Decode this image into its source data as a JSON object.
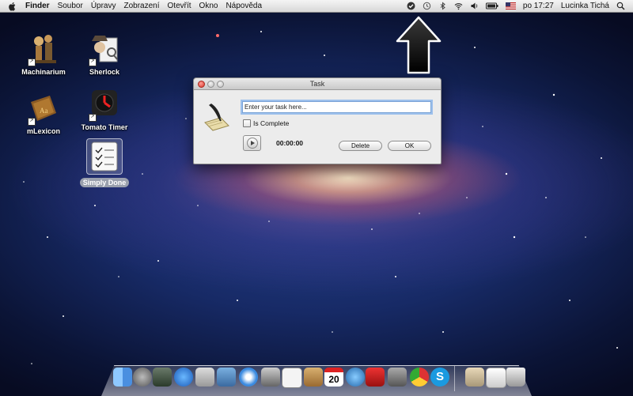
{
  "menubar": {
    "app_name": "Finder",
    "items": [
      "Soubor",
      "Úpravy",
      "Zobrazení",
      "Otevřít",
      "Okno",
      "Nápověda"
    ],
    "clock": "po 17:27",
    "user": "Lucinka Tichá"
  },
  "desktop": {
    "icons": [
      {
        "label": "Machinarium"
      },
      {
        "label": "Sherlock"
      },
      {
        "label": "mLexicon"
      },
      {
        "label": "Tomato Timer"
      },
      {
        "label": "Simply Done"
      }
    ]
  },
  "dialog": {
    "title": "Task",
    "task_placeholder": "Enter your task here...",
    "checkbox_label": "Is Complete",
    "timer": "00:00:00",
    "delete_label": "Delete",
    "ok_label": "OK"
  },
  "dock": {
    "icons": [
      "finder-icon",
      "launchpad-icon",
      "mission-control-icon",
      "app-store-icon",
      "preview-icon",
      "iphoto-icon",
      "safari-icon",
      "facetime-icon",
      "simply-done-icon",
      "contacts-icon",
      "calendar-icon",
      "itunes-icon",
      "photo-booth-icon",
      "system-preferences-icon",
      "chrome-icon",
      "skype-icon",
      "documents-icon",
      "downloads-icon",
      "trash-icon"
    ],
    "calendar_day": "20"
  },
  "colors": {
    "menubar": "#e6e6e6",
    "focus_ring": "#9dc0ec",
    "close_button": "#d9362b"
  }
}
